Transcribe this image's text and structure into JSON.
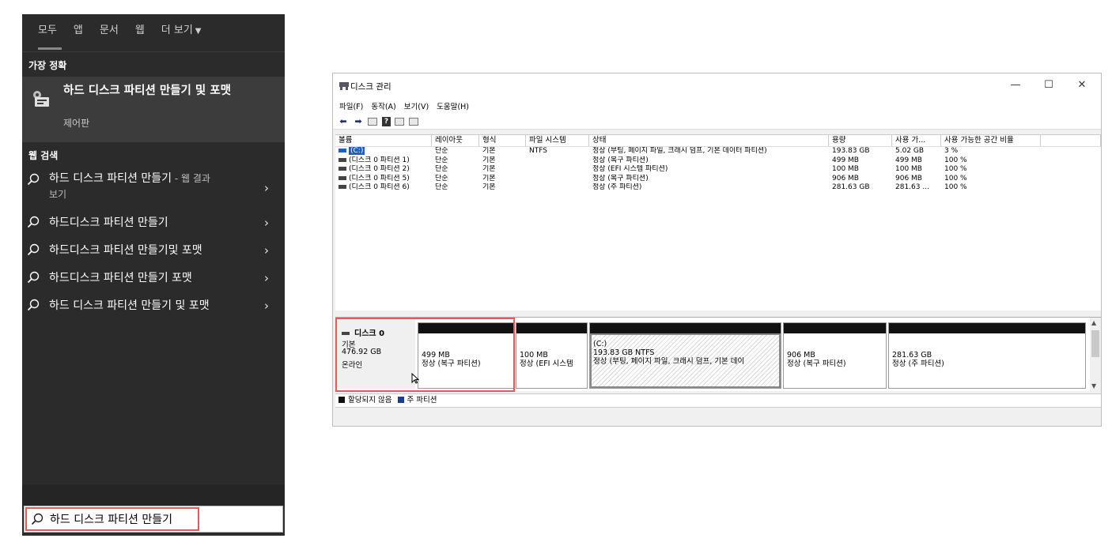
{
  "start_menu": {
    "tabs": [
      "모두",
      "앱",
      "문서",
      "웹",
      "더 보기"
    ],
    "best_match_header": "가장 정확",
    "best_match": {
      "title": "하드 디스크 파티션 만들기 및 포맷",
      "subtitle": "제어판"
    },
    "web_search_header": "웹 검색",
    "web_results": [
      {
        "text": "하드 디스크 파티션 만들기",
        "suffix": " - 웹 결과",
        "second": "보기"
      },
      {
        "text": "하드디스크 파티션 만들기"
      },
      {
        "text": "하드디스크 파티션 만들기및 포맷"
      },
      {
        "text": "하드디스크 파티션 만들기 포맷"
      },
      {
        "text": "하드 디스크 파티션 만들기 및 포맷"
      }
    ],
    "search_value": "하드 디스크 파티션 만들기"
  },
  "window": {
    "title": "디스크 관리",
    "controls": {
      "minimize": "—",
      "maximize": "☐",
      "close": "✕"
    },
    "menu": [
      "파일(F)",
      "동작(A)",
      "보기(V)",
      "도움말(H)"
    ],
    "columns": [
      "볼륨",
      "레이아웃",
      "형식",
      "파일 시스템",
      "상태",
      "용량",
      "사용 가...",
      "사용 가능한 공간 비율",
      ""
    ],
    "rows": [
      {
        "volume": "(C:)",
        "layout": "단순",
        "type": "기본",
        "fs": "NTFS",
        "status": "정상 (부팅, 페이지 파일, 크래시 덤프, 기본 데이터 파티션)",
        "capacity": "193.83 GB",
        "free": "5.02 GB",
        "pct": "3 %"
      },
      {
        "volume": "(디스크 0 파티션 1)",
        "layout": "단순",
        "type": "기본",
        "fs": "",
        "status": "정상 (복구 파티션)",
        "capacity": "499 MB",
        "free": "499 MB",
        "pct": "100 %"
      },
      {
        "volume": "(디스크 0 파티션 2)",
        "layout": "단순",
        "type": "기본",
        "fs": "",
        "status": "정상 (EFI 시스템 파티션)",
        "capacity": "100 MB",
        "free": "100 MB",
        "pct": "100 %"
      },
      {
        "volume": "(디스크 0 파티션 5)",
        "layout": "단순",
        "type": "기본",
        "fs": "",
        "status": "정상 (복구 파티션)",
        "capacity": "906 MB",
        "free": "906 MB",
        "pct": "100 %"
      },
      {
        "volume": "(디스크 0 파티션 6)",
        "layout": "단순",
        "type": "기본",
        "fs": "",
        "status": "정상 (주 파티션)",
        "capacity": "281.63 GB",
        "free": "281.63 ...",
        "pct": "100 %"
      }
    ],
    "disk": {
      "name": "디스크 0",
      "type": "기본",
      "size": "476.92 GB",
      "state": "온라인"
    },
    "partitions": [
      {
        "title": "",
        "line1": "499 MB",
        "line2": "정상 (복구 파티션)"
      },
      {
        "title": "",
        "line1": "100 MB",
        "line2": "정상 (EFI 시스템"
      },
      {
        "title": "(C:)",
        "line1": "193.83 GB NTFS",
        "line2": "정상 (부팅, 페이지 파일, 크래시 덤프, 기본 데이"
      },
      {
        "title": "",
        "line1": "906 MB",
        "line2": "정상 (복구 파티션)"
      },
      {
        "title": "",
        "line1": "281.63 GB",
        "line2": "정상 (주 파티션)"
      }
    ],
    "legend": [
      "할당되지 않음",
      "주 파티션"
    ]
  }
}
